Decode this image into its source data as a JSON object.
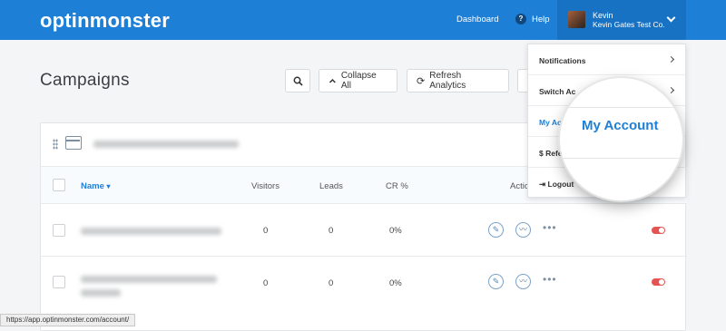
{
  "header": {
    "logo": "optinmonster",
    "nav_dashboard": "Dashboard",
    "nav_help_icon": "?",
    "nav_help": "Help",
    "user_name": "Kevin",
    "user_company": "Kevin Gates Test Co."
  },
  "page": {
    "title": "Campaigns"
  },
  "toolbar": {
    "search_icon": "search-icon",
    "collapse_label": "Collapse All",
    "refresh_label": "Refresh Analytics"
  },
  "table": {
    "columns": {
      "name": "Name",
      "visitors": "Visitors",
      "leads": "Leads",
      "cr": "CR %",
      "actions": "Actio"
    },
    "rows": [
      {
        "visitors": "0",
        "leads": "0",
        "cr": "0%"
      },
      {
        "visitors": "0",
        "leads": "0",
        "cr": "0%"
      }
    ]
  },
  "dropdown": {
    "items": [
      {
        "label": "Notifications"
      },
      {
        "label": "Switch Ac"
      },
      {
        "label": "My Ac"
      },
      {
        "label": "$ Refe"
      },
      {
        "label": "Logout"
      }
    ]
  },
  "magnifier": {
    "label": "My Account"
  },
  "statusbar": {
    "url": "https://app.optinmonster.com/account/"
  },
  "colors": {
    "brand_blue": "#1e7fd6",
    "toggle_red": "#e55353"
  }
}
